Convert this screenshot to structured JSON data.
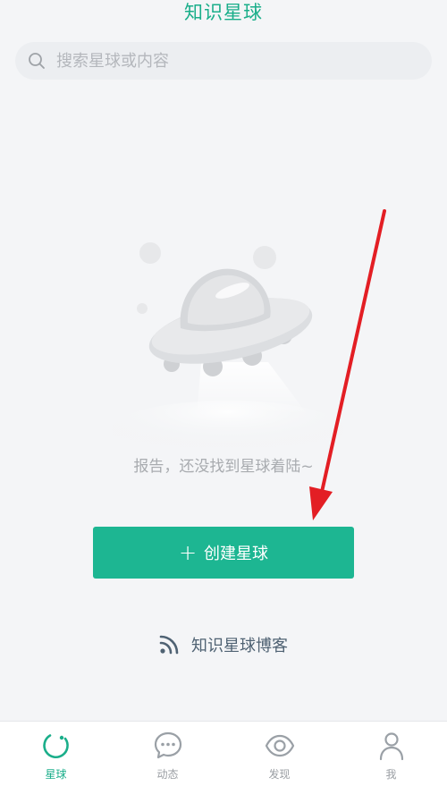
{
  "header": {
    "title": "知识星球"
  },
  "search": {
    "placeholder": "搜索星球或内容"
  },
  "empty_state": {
    "message": "报告，还没找到星球着陆~",
    "illustration": "ufo-icon"
  },
  "actions": {
    "create_plus": "+",
    "create_label": "创建星球",
    "blog_label": "知识星球博客"
  },
  "tabbar": {
    "items": [
      {
        "label": "星球",
        "icon": "planet-icon",
        "active": true
      },
      {
        "label": "动态",
        "icon": "chat-bubble-icon",
        "active": false
      },
      {
        "label": "发现",
        "icon": "eye-icon",
        "active": false
      },
      {
        "label": "我",
        "icon": "person-icon",
        "active": false
      }
    ]
  },
  "colors": {
    "accent": "#1db692",
    "background": "#f4f5f7",
    "annotation_arrow": "#e31e24"
  }
}
